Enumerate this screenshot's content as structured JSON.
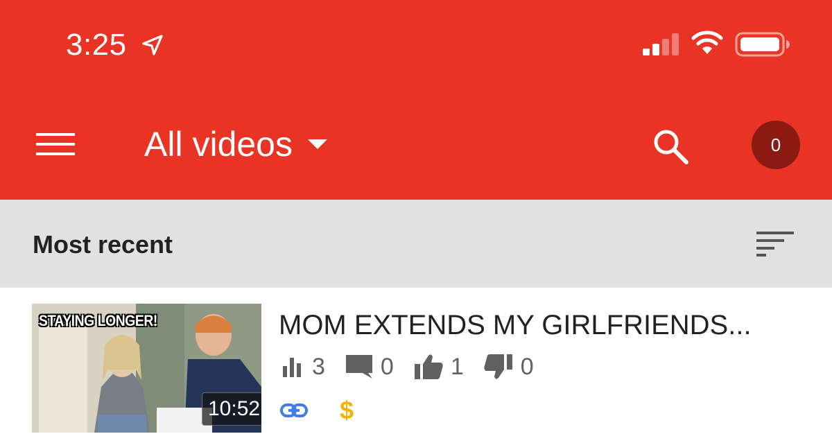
{
  "status_bar": {
    "time": "3:25",
    "icons": [
      "location-arrow-icon",
      "signal-icon",
      "wifi-icon",
      "battery-icon"
    ]
  },
  "app_bar": {
    "title": "All videos",
    "notification_count": "0",
    "icons": [
      "menu-icon",
      "dropdown-icon",
      "search-icon"
    ],
    "background_color": "#e93324",
    "badge_color": "#8a1a12"
  },
  "filter": {
    "label": "Most recent",
    "icon": "sort-icon"
  },
  "videos": [
    {
      "thumbnail_caption": "STAYING LONGER!",
      "duration": "10:52",
      "title": "MOM EXTENDS MY GIRLFRIENDS...",
      "views": "3",
      "comments": "0",
      "likes": "1",
      "dislikes": "0",
      "badges": [
        "link-icon",
        "monetization-icon"
      ],
      "monetization_symbol": "$"
    }
  ]
}
